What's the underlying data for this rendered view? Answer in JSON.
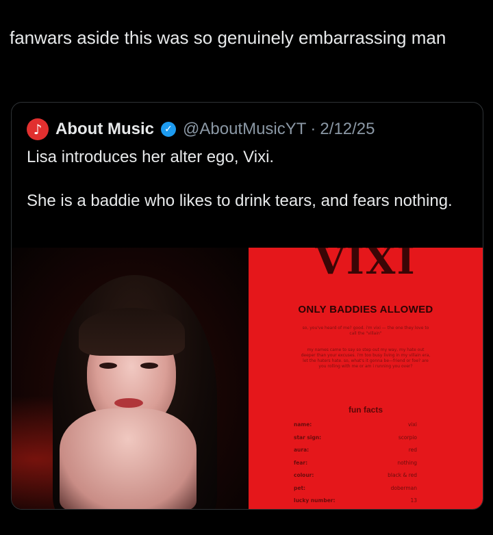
{
  "post": {
    "text": "fanwars aside this was so genuinely embarrassing man"
  },
  "quote": {
    "avatar_icon": "music-note-icon",
    "avatar_glyph": "♪",
    "author_name": "About Music",
    "verified_glyph": "✓",
    "handle": "@AboutMusicYT",
    "separator": "·",
    "date": "2/12/25",
    "body": "Lisa introduces her alter ego, Vixi.\n\nShe is a baddie who likes to drink tears, and fears nothing."
  },
  "poster": {
    "title": "VIXI",
    "heading": "ONLY BADDIES ALLOWED",
    "para1": "so, you've heard of me? good. i'm vixi — the one they love to call the \"villain\"",
    "para2": "my names came to say so step out my way, my hate out deeper than your excuses. i'm too busy living in my villain era, let the haters hate. so, what's it gonna be—friend or foe? are you rolling with me or am i running you over?",
    "fun_facts_heading": "fun facts",
    "facts": [
      {
        "key": "name:",
        "value": "vixi"
      },
      {
        "key": "star sign:",
        "value": "scorpio"
      },
      {
        "key": "aura:",
        "value": "red"
      },
      {
        "key": "fear:",
        "value": "nothing"
      },
      {
        "key": "colour:",
        "value": "black & red"
      },
      {
        "key": "pet:",
        "value": "doberman"
      },
      {
        "key": "lucky number:",
        "value": "13"
      }
    ]
  },
  "colors": {
    "background": "#000000",
    "text": "#e7e9ea",
    "secondary_text": "#8b98a5",
    "verified": "#1d9bf0",
    "poster_red": "#e5171b"
  }
}
